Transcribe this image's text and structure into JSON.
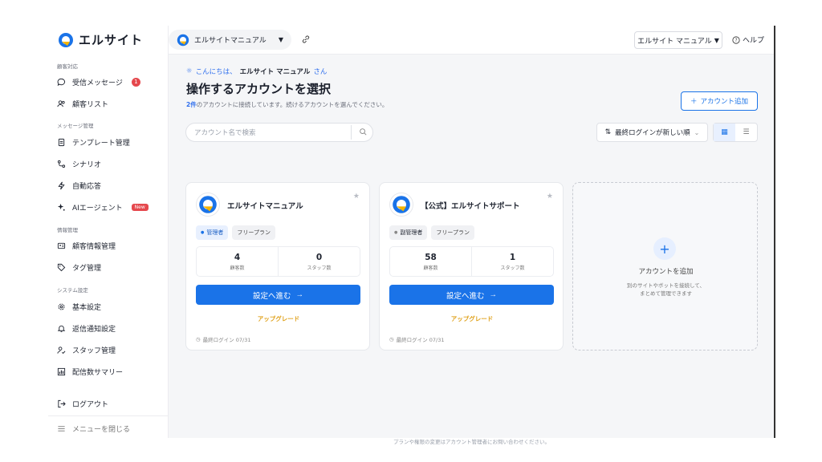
{
  "app": {
    "logo_text": "エルサイト"
  },
  "sidebar": {
    "sections": {
      "customer": "顧客対応",
      "message": "メッセージ管理",
      "info": "情報管理",
      "system": "システム設定"
    },
    "items": {
      "inbox": {
        "label": "受信メッセージ",
        "badge": "1"
      },
      "customers": {
        "label": "顧客リスト"
      },
      "templates": {
        "label": "テンプレート管理"
      },
      "scenario": {
        "label": "シナリオ"
      },
      "autoreply": {
        "label": "自動応答"
      },
      "ai_agent": {
        "label": "AIエージェント",
        "badge": "New"
      },
      "customer_info": {
        "label": "顧客情報管理"
      },
      "tags": {
        "label": "タグ管理"
      },
      "basic_settings": {
        "label": "基本設定"
      },
      "reply_notify": {
        "label": "返信通知設定"
      },
      "staff": {
        "label": "スタッフ管理"
      },
      "delivery_summary": {
        "label": "配信数サマリー"
      }
    },
    "logout": "ログアウト",
    "close_menu": "メニューを閉じる"
  },
  "topbar": {
    "current_account": "エルサイトマニュアル",
    "user_name": "エルサイト マニュアル",
    "help": "ヘルプ"
  },
  "main": {
    "greeting_prefix": "こんにちは、",
    "greeting_name": "エルサイト マニュアル",
    "greeting_suffix": "さん",
    "title": "操作するアカウントを選択",
    "subtitle_count": "2件",
    "subtitle_rest": "のアカウントに接続しています。続けるアカウントを選んでください。",
    "add_account_button": "アカウント追加",
    "search_placeholder": "アカウント名で検索",
    "sort_label": "最終ログインが新しい順"
  },
  "accounts": [
    {
      "name": "エルサイトマニュアル",
      "role": "管理者",
      "plan": "フリープラン",
      "customers": "4",
      "customers_label": "顧客数",
      "staff": "0",
      "staff_label": "スタッフ数",
      "go_button": "設定へ進む",
      "upgrade": "アップグレード",
      "last_login": "最終ログイン 07/31"
    },
    {
      "name": "【公式】エルサイトサポート",
      "role": "副管理者",
      "plan": "フリープラン",
      "customers": "58",
      "customers_label": "顧客数",
      "staff": "1",
      "staff_label": "スタッフ数",
      "go_button": "設定へ進む",
      "upgrade": "アップグレード",
      "last_login": "最終ログイン 07/31"
    }
  ],
  "add_card": {
    "label": "アカウントを追加",
    "desc_line1": "別のサイトやボットを接続して、",
    "desc_line2": "まとめて管理できます"
  },
  "footer_note": "プランや権限の変更はアカウント管理者にお問い合わせください。",
  "colors": {
    "accent": "#1a73e8",
    "badge": "#e5484d",
    "upgrade": "#e0a21d"
  }
}
